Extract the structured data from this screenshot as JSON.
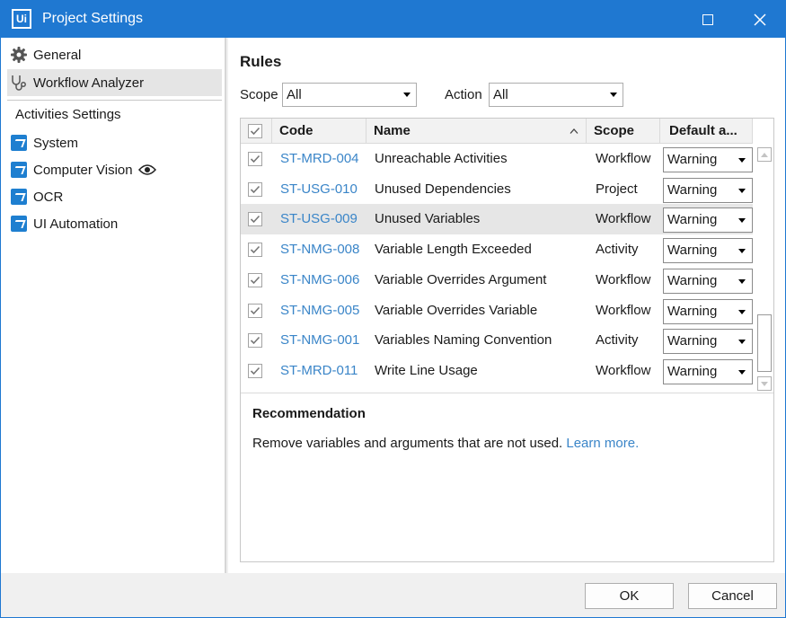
{
  "window": {
    "logo": "Ui",
    "title": "Project Settings"
  },
  "sidebar": {
    "general": "General",
    "workflow_analyzer": "Workflow Analyzer",
    "section": "Activities Settings",
    "system": "System",
    "computer_vision": "Computer Vision",
    "ocr": "OCR",
    "ui_automation": "UI Automation"
  },
  "rules": {
    "title": "Rules",
    "scope_label": "Scope",
    "scope_value": "All",
    "action_label": "Action",
    "action_value": "All"
  },
  "grid": {
    "columns": [
      "Code",
      "Name",
      "Scope",
      "Default a..."
    ],
    "rows": [
      {
        "code": "ST-MRD-004",
        "name": "Unreachable Activities",
        "scope": "Workflow",
        "action": "Warning"
      },
      {
        "code": "ST-USG-010",
        "name": "Unused Dependencies",
        "scope": "Project",
        "action": "Warning"
      },
      {
        "code": "ST-USG-009",
        "name": "Unused Variables",
        "scope": "Workflow",
        "action": "Warning"
      },
      {
        "code": "ST-NMG-008",
        "name": "Variable Length Exceeded",
        "scope": "Activity",
        "action": "Warning"
      },
      {
        "code": "ST-NMG-006",
        "name": "Variable Overrides Argument",
        "scope": "Workflow",
        "action": "Warning"
      },
      {
        "code": "ST-NMG-005",
        "name": "Variable Overrides Variable",
        "scope": "Workflow",
        "action": "Warning"
      },
      {
        "code": "ST-NMG-001",
        "name": "Variables Naming Convention",
        "scope": "Activity",
        "action": "Warning"
      },
      {
        "code": "ST-MRD-011",
        "name": "Write Line Usage",
        "scope": "Workflow",
        "action": "Warning"
      }
    ]
  },
  "recommendation": {
    "title": "Recommendation",
    "text": "Remove variables and arguments that are not used.",
    "link": "Learn more."
  },
  "footer": {
    "ok": "OK",
    "cancel": "Cancel"
  }
}
